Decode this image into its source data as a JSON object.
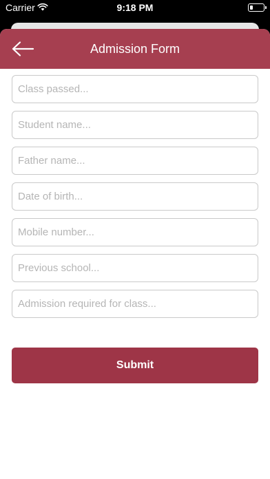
{
  "status_bar": {
    "carrier": "Carrier",
    "time": "9:18 PM",
    "icons": [
      "wifi-icon",
      "battery-icon"
    ]
  },
  "header": {
    "title": "Admission Form",
    "back_icon": "arrow-left-icon",
    "color": "#a63f50"
  },
  "form": {
    "fields": [
      {
        "placeholder": "Class passed..."
      },
      {
        "placeholder": "Student name..."
      },
      {
        "placeholder": "Father name..."
      },
      {
        "placeholder": "Date of birth..."
      },
      {
        "placeholder": "Mobile number..."
      },
      {
        "placeholder": "Previous school..."
      },
      {
        "placeholder": "Admission required for class..."
      }
    ],
    "submit_label": "Submit",
    "submit_color": "#9e3547"
  }
}
